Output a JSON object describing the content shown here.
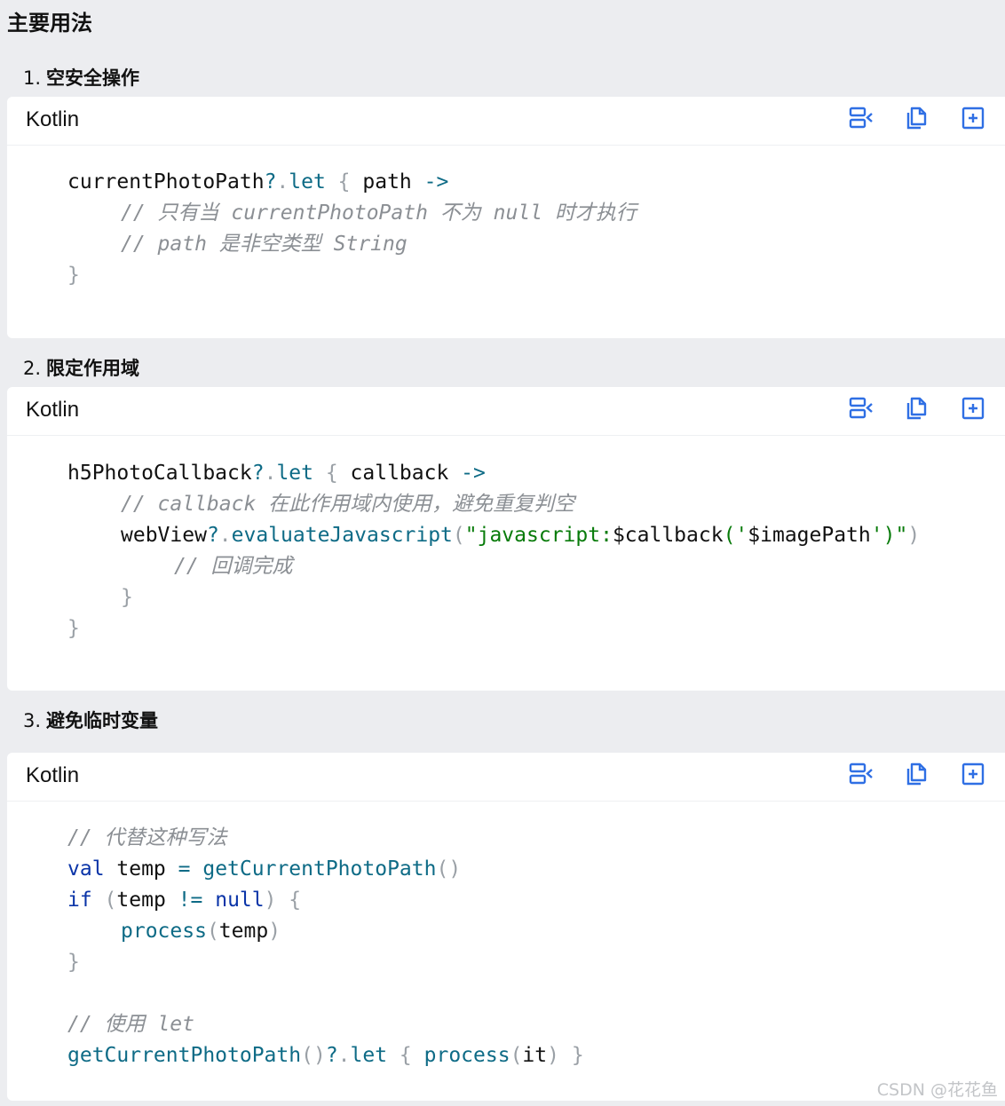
{
  "heading": "主要用法",
  "sections": [
    {
      "num": "1.",
      "title": "空安全操作",
      "lang": "Kotlin"
    },
    {
      "num": "2.",
      "title": "限定作用域",
      "lang": "Kotlin"
    },
    {
      "num": "3.",
      "title": "避免临时变量",
      "lang": "Kotlin"
    }
  ],
  "icons": [
    "wrap-lines-icon",
    "copy-icon",
    "expand-icon"
  ],
  "colors": {
    "accent": "#2f6fe4",
    "keyword": "#0a34a8",
    "function": "#0e6b86",
    "string": "#087b0a",
    "comment": "#8b8f94"
  },
  "code1": {
    "l1a": "currentPhotoPath",
    "l1b": "?",
    "l1c": ".",
    "l1d": "let",
    "l1e": " { ",
    "l1f": "path",
    "l1g": " ->",
    "l2": "// 只有当 currentPhotoPath 不为 null 时才执行",
    "l3": "// path 是非空类型 String",
    "l4": "}"
  },
  "code2": {
    "l1a": "h5PhotoCallback",
    "l1b": "?",
    "l1c": ".",
    "l1d": "let",
    "l1e": " { ",
    "l1f": "callback",
    "l1g": " ->",
    "l2": "// callback 在此作用域内使用，避免重复判空",
    "l3a": "webView",
    "l3b": "?",
    "l3c": ".",
    "l3d": "evaluateJavascript",
    "l3e": "(",
    "l3f": "\"javascript:",
    "l3g": "$callback",
    "l3h": "(",
    "l3i": "'",
    "l3j": "$imagePath",
    "l3k": "'",
    "l3l": ")\"",
    "l3m": ")",
    "l4": "// 回调完成",
    "l5": "}",
    "l6": "}"
  },
  "code3": {
    "l1": "// 代替这种写法",
    "l2a": "val",
    "l2b": " temp ",
    "l2c": "=",
    "l2d": " ",
    "l2e": "getCurrentPhotoPath",
    "l2f": "()",
    "l3a": "if",
    "l3b": " (",
    "l3c": "temp ",
    "l3d": "!=",
    "l3e": " ",
    "l3f": "null",
    "l3g": ") {",
    "l4a": "process",
    "l4b": "(",
    "l4c": "temp",
    "l4d": ")",
    "l5": "}",
    "l6": "// 使用 let",
    "l7a": "getCurrentPhotoPath",
    "l7b": "()",
    "l7c": "?",
    "l7d": ".",
    "l7e": "let",
    "l7f": " { ",
    "l7g": "process",
    "l7h": "(",
    "l7i": "it",
    "l7j": ") }"
  },
  "watermark": "CSDN @花花鱼"
}
